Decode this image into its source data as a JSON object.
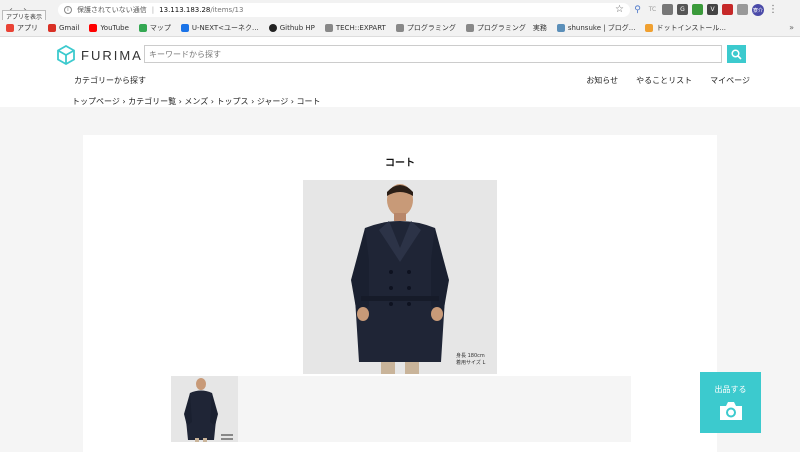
{
  "browser": {
    "tooltip": "アプリを表示",
    "security_label": "保護されていない通信",
    "url_host": "13.113.183.28",
    "url_path": "/items/13",
    "profile_initials": "寮介",
    "ext_labels": [
      "TC",
      "G",
      "V"
    ]
  },
  "bookmarks": [
    {
      "label": "アプリ",
      "color": "#e94235"
    },
    {
      "label": "Gmail",
      "color": "#d93025"
    },
    {
      "label": "YouTube",
      "color": "#ff0000"
    },
    {
      "label": "マップ",
      "color": "#34a853"
    },
    {
      "label": "U-NEXT<ユーネク...",
      "color": "#1a73e8"
    },
    {
      "label": "Github HP",
      "color": "#222222"
    },
    {
      "label": "TECH::EXPART",
      "color": "#888888"
    },
    {
      "label": "プログラミング",
      "color": "#888888"
    },
    {
      "label": "プログラミング　実務",
      "color": "#888888"
    },
    {
      "label": "shunsuke | ブログ...",
      "color": "#5b8fb9"
    },
    {
      "label": "ドットインストール...",
      "color": "#f0a030"
    }
  ],
  "header": {
    "logo": "FURIMA",
    "search_placeholder": "キーワードから探す",
    "category_link": "カテゴリーから探す",
    "nav": [
      "お知らせ",
      "やることリスト",
      "マイページ"
    ],
    "breadcrumb": "トップページ › カテゴリー覧 › メンズ › トップス › ジャージ › コート"
  },
  "item": {
    "title": "コート",
    "image_caption_line1": "身長 180cm",
    "image_caption_line2": "着用サイズ L"
  },
  "listing_button": {
    "label": "出品する"
  },
  "colors": {
    "accent": "#3ccace",
    "coat": "#1f2536"
  }
}
